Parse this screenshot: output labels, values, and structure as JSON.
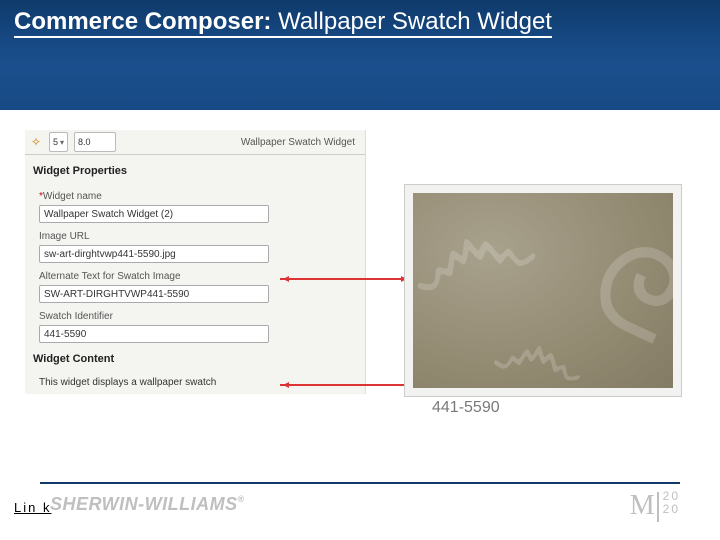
{
  "title": {
    "bold": "Commerce Composer:",
    "rest": " Wallpaper Swatch Widget"
  },
  "toolbar": {
    "field1": "5",
    "field2": "8.0",
    "crumb": "Wallpaper Swatch Widget"
  },
  "sections": {
    "props": "Widget Properties",
    "content": "Widget Content"
  },
  "form": {
    "name_label": "Widget name",
    "name_value": "Wallpaper Swatch Widget (2)",
    "url_label": "Image URL",
    "url_value": "sw-art-dirghtvwp441-5590.jpg",
    "alt_label": "Alternate Text for Swatch Image",
    "alt_value": "SW-ART-DIRGHTVWP441-5590",
    "id_label": "Swatch Identifier",
    "id_value": "441-5590",
    "req": "*"
  },
  "content_desc": "This widget displays a wallpaper swatch",
  "swatch_caption": "441-5590",
  "footer": {
    "link": "Lin k",
    "brand": "SHERWIN-WILLIAMS",
    "reg": "®",
    "m": "M",
    "y1": "20",
    "y2": "20"
  }
}
